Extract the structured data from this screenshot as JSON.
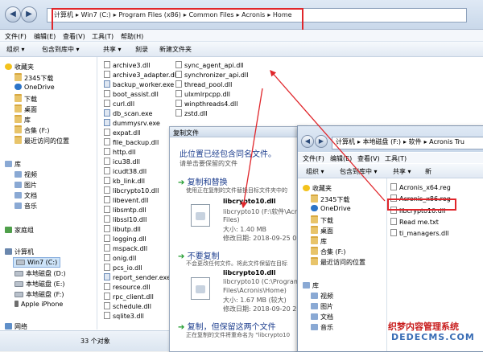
{
  "main": {
    "breadcrumb": [
      "计算机",
      "Win7 (C:)",
      "Program Files (x86)",
      "Common Files",
      "Acronis",
      "Home"
    ],
    "menu": [
      "文件(F)",
      "编辑(E)",
      "查看(V)",
      "工具(T)",
      "帮助(H)"
    ],
    "toolbar": [
      "组织 ▾",
      "包含到库中 ▾",
      "共享 ▾",
      "刻录",
      "新建文件夹"
    ],
    "nav_tree": [
      {
        "label": "收藏夹",
        "icon": "star"
      },
      {
        "label": "2345下载",
        "icon": "folder"
      },
      {
        "label": "OneDrive",
        "icon": "cloud"
      },
      {
        "label": "下载",
        "icon": "folder"
      },
      {
        "label": "桌面",
        "icon": "folder"
      },
      {
        "label": "库",
        "icon": "folder"
      },
      {
        "label": "合集 (F:)",
        "icon": "folder"
      },
      {
        "label": "最近访问的位置",
        "icon": "folder"
      },
      {
        "label": "库",
        "icon": "lib"
      },
      {
        "label": "视频",
        "icon": "lib"
      },
      {
        "label": "图片",
        "icon": "lib"
      },
      {
        "label": "文档",
        "icon": "lib"
      },
      {
        "label": "音乐",
        "icon": "lib"
      },
      {
        "label": "家庭组",
        "icon": "home"
      },
      {
        "label": "计算机",
        "icon": "pc"
      },
      {
        "label": "Win7 (C:)",
        "icon": "drive"
      },
      {
        "label": "本地磁盘 (D:)",
        "icon": "drive"
      },
      {
        "label": "本地磁盘 (E:)",
        "icon": "drive"
      },
      {
        "label": "本地磁盘 (F:)",
        "icon": "drive"
      },
      {
        "label": "Apple iPhone",
        "icon": "phone"
      },
      {
        "label": "网络",
        "icon": "net"
      }
    ],
    "files_col1": [
      "archive3.dll",
      "archive3_adapter.dll",
      "backup_worker.exe",
      "boot_assist.dll",
      "curl.dll",
      "db_scan.exe",
      "dummysrv.exe",
      "expat.dll",
      "file_backup.dll",
      "http.dll",
      "icu38.dll",
      "icudt38.dll",
      "kb_link.dll",
      "libcrypto10.dll",
      "libevent.dll",
      "libsmtp.dll",
      "libssl10.dll",
      "libutp.dll",
      "logging.dll",
      "mspack.dll",
      "onig.dll",
      "pcs_io.dll",
      "report_sender.exe",
      "resource.dll",
      "rpc_client.dll",
      "schedule.dll",
      "sqlite3.dll"
    ],
    "files_col2": [
      "sync_agent_api.dll",
      "synchronizer_api.dll",
      "thread_pool.dll",
      "ulxmlrpcpp.dll",
      "winpthreads4.dll",
      "zstd.dll"
    ],
    "status": "33 个对象"
  },
  "dialog": {
    "title": "复制文件",
    "heading": "此位置已经包含同名文件。",
    "instruction": "请单击要保留的文件",
    "option1": {
      "title": "复制和替换",
      "desc": "使用正在复制的文件替换目标文件夹中的",
      "file": "libcrypto10.dll",
      "path": "libcrypto10 (F:\\软件\\Acronis",
      "path2": "Files)",
      "size": "大小: 1.40 MB",
      "modified": "修改日期: 2018-09-25 0:20"
    },
    "option2": {
      "title": "不要复制",
      "desc": "不会更改任何文件。将此文件保留在目标",
      "file": "libcrypto10.dll",
      "path": "libcrypto10 (C:\\Program",
      "path2": "Files\\Acronis\\Home)",
      "size": "大小: 1.67 MB (较大)",
      "modified": "修改日期: 2018-09-20 20:09"
    },
    "option3": {
      "title": "复制，但保留这两个文件",
      "desc": "正在复制的文件将重命名为 \"libcrypto10"
    }
  },
  "second": {
    "breadcrumb": [
      "计算机",
      "本地磁盘 (F:)",
      "软件",
      "Acronis Tru"
    ],
    "menu": [
      "文件(F)",
      "编辑(E)",
      "查看(V)",
      "工具(T)"
    ],
    "toolbar": [
      "组织 ▾",
      "包含到库中 ▾",
      "共享 ▾",
      "新"
    ],
    "nav_tree": [
      {
        "label": "收藏夹",
        "icon": "star"
      },
      {
        "label": "2345下载",
        "icon": "folder"
      },
      {
        "label": "OneDrive",
        "icon": "cloud"
      },
      {
        "label": "下载",
        "icon": "folder"
      },
      {
        "label": "桌面",
        "icon": "folder"
      },
      {
        "label": "库",
        "icon": "folder"
      },
      {
        "label": "合集 (F:)",
        "icon": "folder"
      },
      {
        "label": "最近访问的位置",
        "icon": "folder"
      },
      {
        "label": "库",
        "icon": "lib"
      },
      {
        "label": "视频",
        "icon": "lib"
      },
      {
        "label": "图片",
        "icon": "lib"
      },
      {
        "label": "文档",
        "icon": "lib"
      },
      {
        "label": "音乐",
        "icon": "lib"
      }
    ],
    "files": [
      "Acronis_x64.reg",
      "Acronis_x86.reg",
      "libcrypto10.dll",
      "Read me.txt",
      "ti_managers.dll"
    ]
  },
  "watermark": {
    "line1": "织梦内容管理系统",
    "line2": "DEDECMS.COM"
  },
  "colors": {
    "highlight": "#e0262b",
    "link_green": "#1b9a2a",
    "heading_blue": "#1e3f8f"
  }
}
